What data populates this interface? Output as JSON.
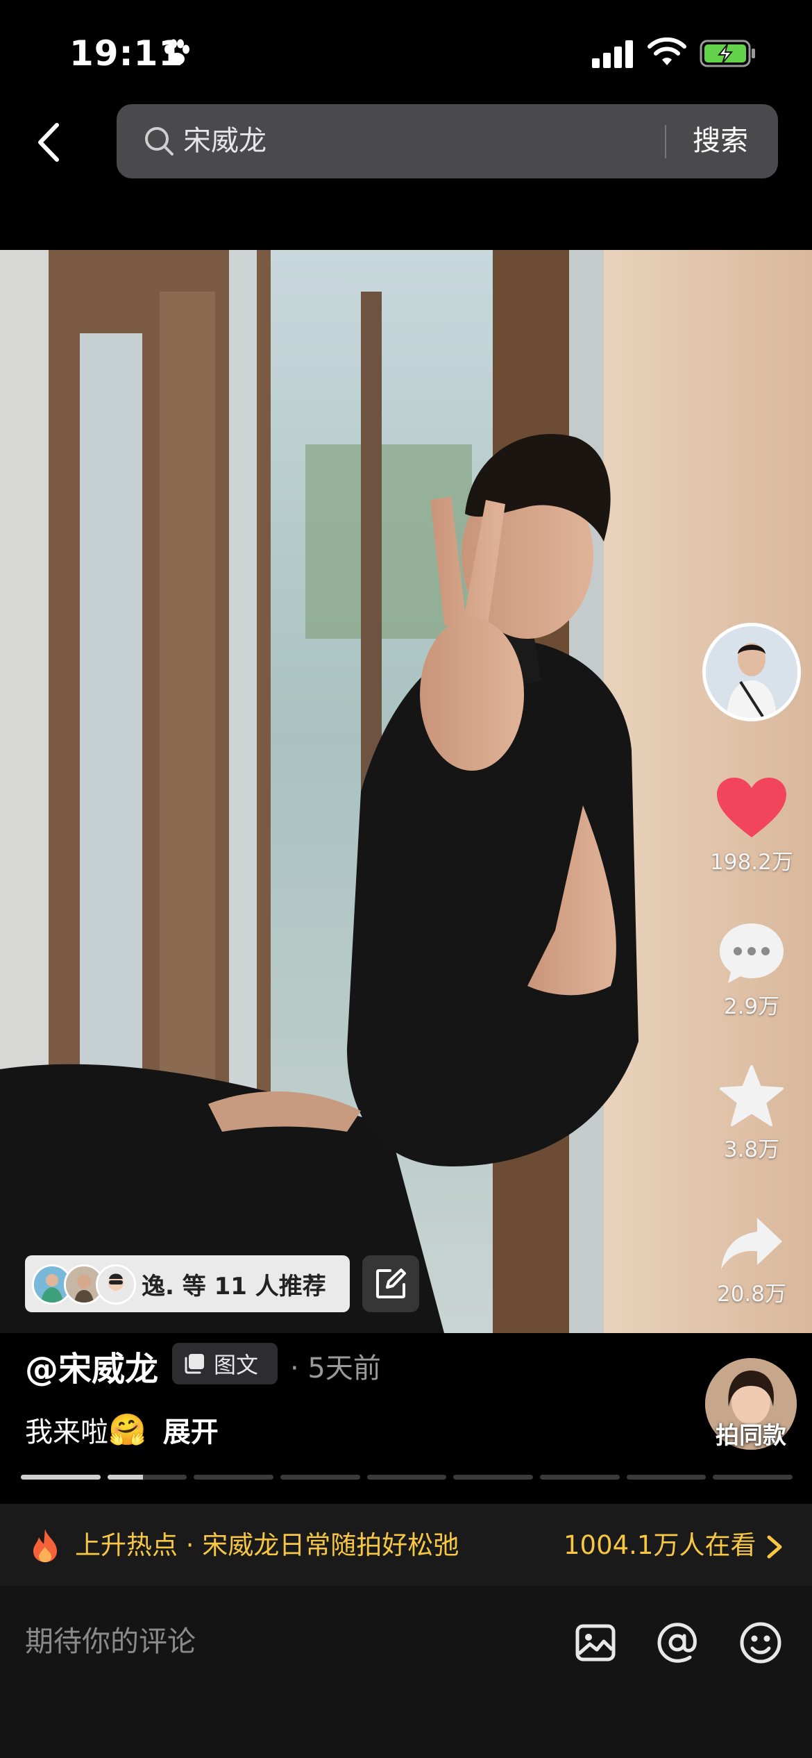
{
  "status": {
    "time": "19:11",
    "battery_color": "#62d34a"
  },
  "search": {
    "value": "宋威龙",
    "button_label": "搜索"
  },
  "post": {
    "author": "@宋威龙",
    "type_label": "图文",
    "time": "· 5天前",
    "caption": "我来啦",
    "caption_emoji": "🤗",
    "expand_label": "展开",
    "recommend_text": "逸. 等 11 人推荐",
    "slide_count": 9,
    "slide_progress": [
      1.0,
      0.45,
      0,
      0,
      0,
      0,
      0,
      0,
      0
    ]
  },
  "actions": {
    "likes": "198.2万",
    "comments": "2.9万",
    "favorites": "3.8万",
    "shares": "20.8万",
    "same_style_label": "拍同款",
    "like_color": "#f2455d"
  },
  "hot": {
    "text": "上升热点 · 宋威龙日常随拍好松弛",
    "count": "1004.1万人在看",
    "color": "#f7c744"
  },
  "comment": {
    "placeholder": "期待你的评论"
  }
}
